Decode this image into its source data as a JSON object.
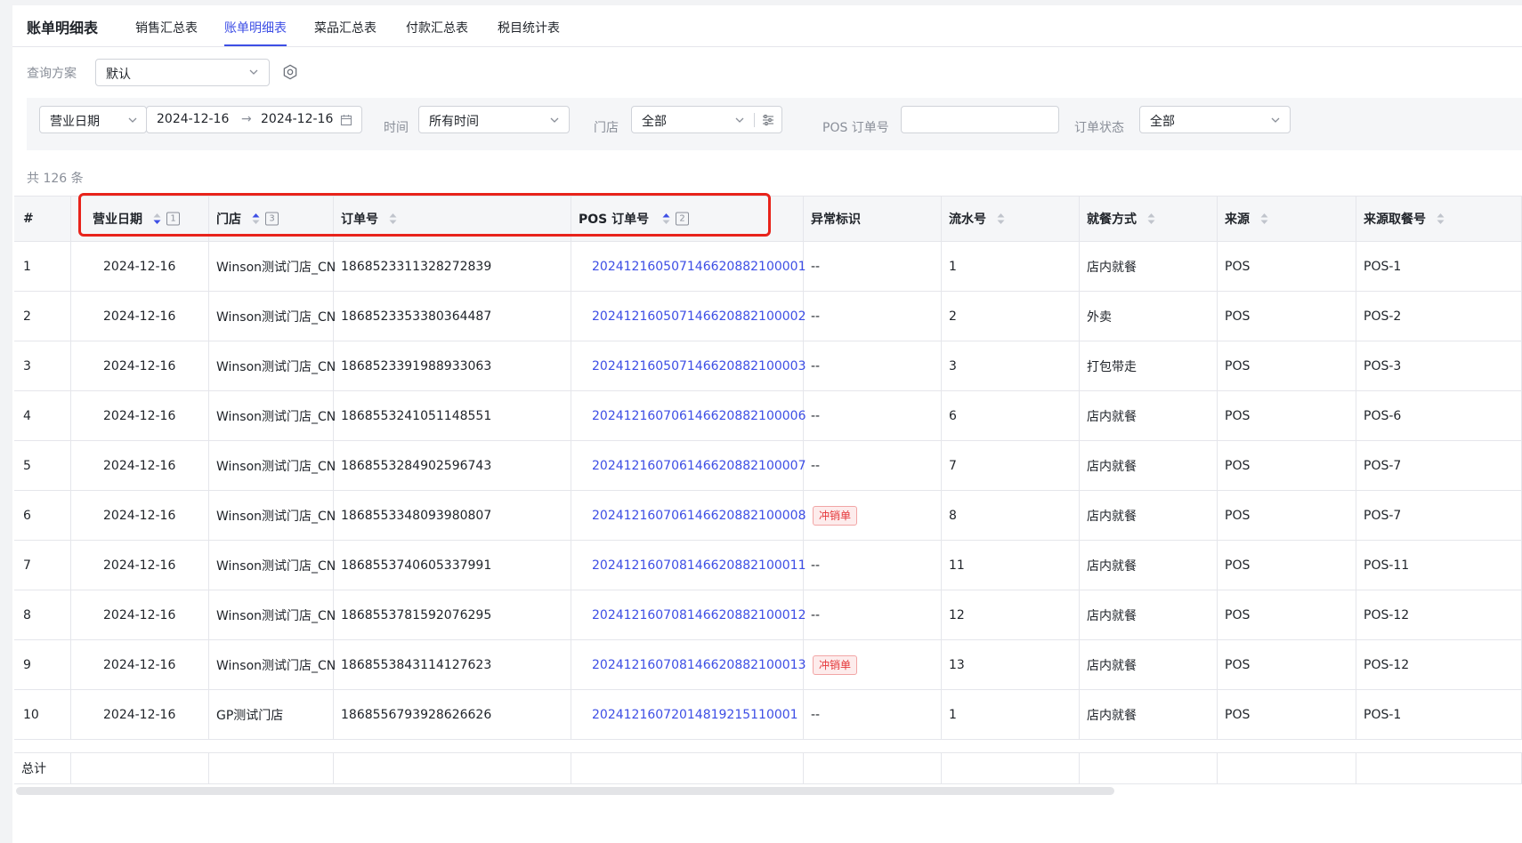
{
  "header": {
    "app_title": "账单明细表",
    "tabs": [
      "销售汇总表",
      "账单明细表",
      "菜品汇总表",
      "付款汇总表",
      "税目统计表"
    ],
    "active_tab": "账单明细表"
  },
  "scheme": {
    "label": "查询方案",
    "value": "默认"
  },
  "filters": {
    "date_type": "营业日期",
    "date_start": "2024-12-16",
    "date_end": "2024-12-16",
    "time_label": "时间",
    "time_value": "所有时间",
    "store_label": "门店",
    "store_value": "全部",
    "pos_label": "POS 订单号",
    "pos_value": "",
    "status_label": "订单状态",
    "status_value": "全部"
  },
  "total_text": "共 126 条",
  "table": {
    "columns": [
      {
        "label": "#",
        "sort": false
      },
      {
        "label": "营业日期",
        "sort": "desc",
        "rank": "1"
      },
      {
        "label": "门店",
        "sort": "asc",
        "rank": "3"
      },
      {
        "label": "订单号",
        "sort": "none"
      },
      {
        "label": "POS 订单号",
        "sort": "asc",
        "rank": "2"
      },
      {
        "label": "异常标识",
        "sort": false
      },
      {
        "label": "流水号",
        "sort": "none"
      },
      {
        "label": "就餐方式",
        "sort": "none"
      },
      {
        "label": "来源",
        "sort": "none"
      },
      {
        "label": "来源取餐号",
        "sort": "none"
      }
    ],
    "rows": [
      [
        "1",
        "2024-12-16",
        "Winson测试门店_CN",
        "1868523311328272839",
        "202412160507146620882100001",
        "--",
        "1",
        "店内就餐",
        "POS",
        "POS-1"
      ],
      [
        "2",
        "2024-12-16",
        "Winson测试门店_CN",
        "1868523353380364487",
        "202412160507146620882100002",
        "--",
        "2",
        "外卖",
        "POS",
        "POS-2"
      ],
      [
        "3",
        "2024-12-16",
        "Winson测试门店_CN",
        "1868523391988933063",
        "202412160507146620882100003",
        "--",
        "3",
        "打包带走",
        "POS",
        "POS-3"
      ],
      [
        "4",
        "2024-12-16",
        "Winson测试门店_CN",
        "1868553241051148551",
        "202412160706146620882100006",
        "--",
        "6",
        "店内就餐",
        "POS",
        "POS-6"
      ],
      [
        "5",
        "2024-12-16",
        "Winson测试门店_CN",
        "1868553284902596743",
        "202412160706146620882100007",
        "--",
        "7",
        "店内就餐",
        "POS",
        "POS-7"
      ],
      [
        "6",
        "2024-12-16",
        "Winson测试门店_CN",
        "1868553348093980807",
        "202412160706146620882100008",
        "冲销单",
        "8",
        "店内就餐",
        "POS",
        "POS-7"
      ],
      [
        "7",
        "2024-12-16",
        "Winson测试门店_CN",
        "1868553740605337991",
        "202412160708146620882100011",
        "--",
        "11",
        "店内就餐",
        "POS",
        "POS-11"
      ],
      [
        "8",
        "2024-12-16",
        "Winson测试门店_CN",
        "1868553781592076295",
        "202412160708146620882100012",
        "--",
        "12",
        "店内就餐",
        "POS",
        "POS-12"
      ],
      [
        "9",
        "2024-12-16",
        "Winson测试门店_CN",
        "1868553843114127623",
        "202412160708146620882100013",
        "冲销单",
        "13",
        "店内就餐",
        "POS",
        "POS-12"
      ],
      [
        "10",
        "2024-12-16",
        "GP测试门店",
        "1868556793928626626",
        "20241216072014819215110001",
        "--",
        "1",
        "店内就餐",
        "POS",
        "POS-1"
      ]
    ],
    "footer_label": "总计"
  },
  "colors": {
    "accent": "#3d4ee5",
    "highlight": "#e8231b",
    "tag_red": "#e5383b"
  }
}
